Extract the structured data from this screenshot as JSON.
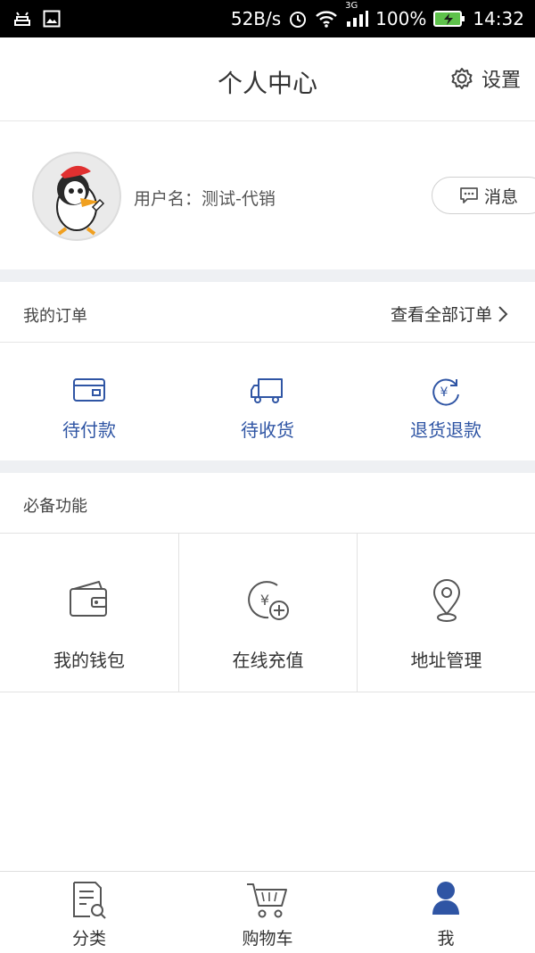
{
  "status_bar": {
    "speed": "52B/s",
    "network": "3G",
    "battery": "100%",
    "time": "14:32"
  },
  "header": {
    "title": "个人中心",
    "settings_label": "设置"
  },
  "profile": {
    "username_label": "用户名：",
    "username_value": "测试-代销",
    "message_label": "消息"
  },
  "orders": {
    "title": "我的订单",
    "view_all": "查看全部订单",
    "items": [
      {
        "label": "待付款",
        "icon": "wallet-card-icon"
      },
      {
        "label": "待收货",
        "icon": "truck-icon"
      },
      {
        "label": "退货退款",
        "icon": "yuan-refund-icon"
      }
    ]
  },
  "features": {
    "title": "必备功能",
    "items": [
      {
        "label": "我的钱包",
        "icon": "wallet-icon"
      },
      {
        "label": "在线充值",
        "icon": "yuan-add-icon"
      },
      {
        "label": "地址管理",
        "icon": "location-pin-icon"
      }
    ]
  },
  "tabbar": {
    "items": [
      {
        "label": "分类",
        "icon": "category-search-icon"
      },
      {
        "label": "购物车",
        "icon": "cart-icon"
      },
      {
        "label": "我",
        "icon": "user-icon"
      }
    ]
  },
  "colors": {
    "accent": "#2f55a4",
    "divider": "#eef0f3"
  }
}
